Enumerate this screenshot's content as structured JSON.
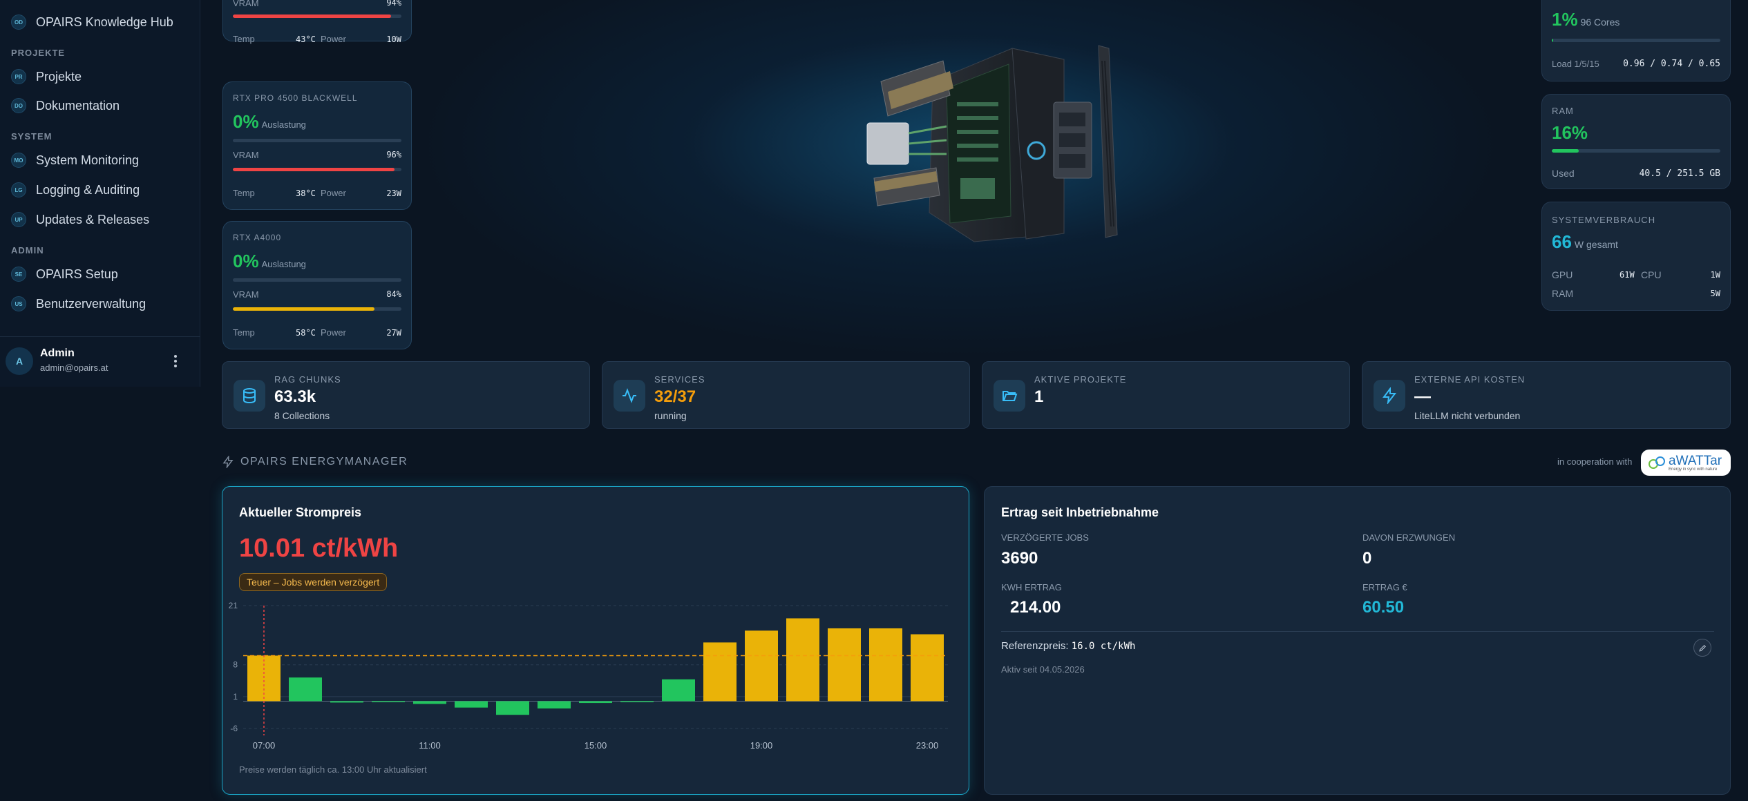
{
  "sidebar": {
    "top_item": {
      "badge": "OD",
      "label": "OPAIRS Knowledge Hub"
    },
    "sections": [
      {
        "title": "PROJEKTE",
        "items": [
          {
            "badge": "PR",
            "label": "Projekte"
          },
          {
            "badge": "DO",
            "label": "Dokumentation"
          }
        ]
      },
      {
        "title": "SYSTEM",
        "items": [
          {
            "badge": "MO",
            "label": "System Monitoring"
          },
          {
            "badge": "LG",
            "label": "Logging & Auditing"
          },
          {
            "badge": "UP",
            "label": "Updates & Releases"
          }
        ]
      },
      {
        "title": "ADMIN",
        "items": [
          {
            "badge": "SE",
            "label": "OPAIRS Setup"
          },
          {
            "badge": "US",
            "label": "Benutzerverwaltung"
          }
        ]
      }
    ],
    "user": {
      "initial": "A",
      "name": "Admin",
      "email": "admin@opairs.at",
      "menu_icon": "more-vertical-icon"
    }
  },
  "gpus": [
    {
      "name": "",
      "util": "",
      "util_label": "",
      "vram_label": "VRAM",
      "vram": "94%",
      "vram_fraction": 0.94,
      "vram_color": "#ef4444",
      "temp_label": "Temp",
      "temp": "43°C",
      "power_label": "Power",
      "power": "10W"
    },
    {
      "name": "RTX PRO 4500 BLACKWELL",
      "util": "0%",
      "util_label": "Auslastung",
      "vram_label": "VRAM",
      "vram": "96%",
      "vram_fraction": 0.96,
      "vram_color": "#ef4444",
      "temp_label": "Temp",
      "temp": "38°C",
      "power_label": "Power",
      "power": "23W"
    },
    {
      "name": "RTX A4000",
      "util": "0%",
      "util_label": "Auslastung",
      "vram_label": "VRAM",
      "vram": "84%",
      "vram_fraction": 0.84,
      "vram_color": "#eab308",
      "temp_label": "Temp",
      "temp": "58°C",
      "power_label": "Power",
      "power": "27W"
    }
  ],
  "cpu": {
    "value": "1%",
    "sub": "96 Cores",
    "fraction": 0.01,
    "load_label": "Load 1/5/15",
    "load": "0.96 / 0.74 / 0.65"
  },
  "ram": {
    "title": "RAM",
    "value": "16%",
    "fraction": 0.16,
    "used_label": "Used",
    "used": "40.5 / 251.5 GB"
  },
  "power": {
    "title": "SYSTEMVERBRAUCH",
    "value": "66",
    "sub": "W gesamt",
    "gpu_label": "GPU",
    "gpu": "61W",
    "cpu_label": "CPU",
    "cpu": "1W",
    "ram_label": "RAM",
    "ram": "5W"
  },
  "kpis": [
    {
      "icon": "database-icon",
      "label": "RAG CHUNKS",
      "value": "63.3k",
      "value_color": "#ffffff",
      "sub": "8 Collections"
    },
    {
      "icon": "activity-icon",
      "label": "SERVICES",
      "value": "32/37",
      "value_color": "#f59e0b",
      "sub": "running"
    },
    {
      "icon": "folder-open-icon",
      "label": "AKTIVE PROJEKTE",
      "value": "1",
      "value_color": "#ffffff",
      "sub": ""
    },
    {
      "icon": "zap-icon",
      "label": "EXTERNE API KOSTEN",
      "value": "—",
      "value_color": "#ffffff",
      "sub": "LiteLLM nicht verbunden"
    }
  ],
  "energy": {
    "section_title": "OPAIRS ENERGYMANAGER",
    "cooperation": "in cooperation with",
    "partner_logo": "aWATTar",
    "partner_tagline": "Energy in sync with nature",
    "price_panel": {
      "title": "Aktueller Strompreis",
      "price": "10.01 ct/kWh",
      "badge": "Teuer – Jobs werden verzögert",
      "footnote": "Preise werden täglich ca. 13:00 Uhr aktualisiert"
    },
    "yield_panel": {
      "title": "Ertrag seit Inbetriebnahme",
      "delayed_label": "VERZÖGERTE JOBS",
      "delayed": "3690",
      "forced_label": "DAVON ERZWUNGEN",
      "forced": "0",
      "kwh_label": "KWH ERTRAG",
      "kwh": "214.00",
      "eur_label": "ERTRAG €",
      "eur": "60.50",
      "ref_label": "Referenzpreis:",
      "ref_value": "16.0 ct/kWh",
      "active_since": "Aktiv seit 04.05.2026"
    }
  },
  "chart_data": {
    "type": "bar",
    "categories": [
      "07:00",
      "08:00",
      "09:00",
      "10:00",
      "11:00",
      "12:00",
      "13:00",
      "14:00",
      "15:00",
      "16:00",
      "17:00",
      "18:00",
      "19:00",
      "20:00",
      "21:00",
      "22:00",
      "23:00"
    ],
    "xticks": [
      "07:00",
      "11:00",
      "15:00",
      "19:00",
      "23:00"
    ],
    "values": [
      10.01,
      5.2,
      -0.3,
      -0.1,
      -0.6,
      -1.4,
      -3.0,
      -1.6,
      -0.4,
      -0.1,
      4.8,
      12.9,
      15.5,
      18.2,
      16.0,
      16.0,
      14.7
    ],
    "yticks": [
      21,
      8,
      1,
      -6
    ],
    "ylim": [
      -6,
      21
    ],
    "threshold": 10.01,
    "current_index": 0,
    "high_color": "#eab308",
    "low_color": "#22c55e"
  }
}
